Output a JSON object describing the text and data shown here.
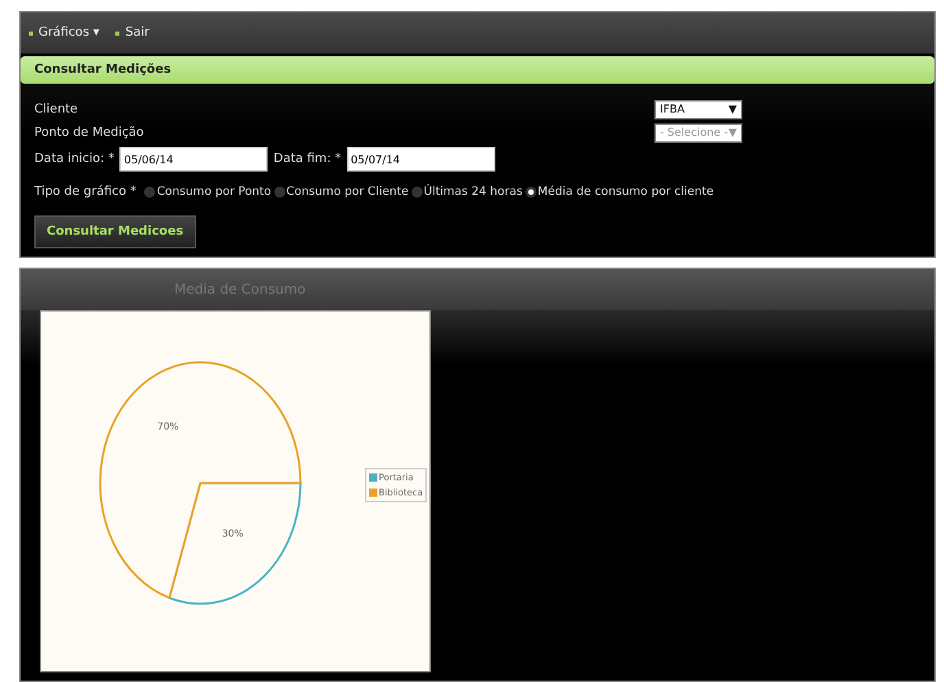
{
  "nav": [
    {
      "label": "Gráficos",
      "caret": "▾"
    },
    {
      "label": "Sair"
    }
  ],
  "form": {
    "title": "Consultar Medições",
    "cliente": {
      "label": "Cliente",
      "value": "IFBA",
      "arrow": "▼"
    },
    "ponto": {
      "label": "Ponto de Medição",
      "placeholder": "- Selecione -",
      "arrow": "▼"
    },
    "data_inicio": {
      "label": "Data inicio: *",
      "value": "05/06/14"
    },
    "data_fim": {
      "label": "Data fim: *",
      "value": "05/07/14"
    },
    "tipo_label": "Tipo de gráfico *",
    "tipos": [
      {
        "label": "Consumo por Ponto",
        "selected": false
      },
      {
        "label": "Consumo por Cliente",
        "selected": false
      },
      {
        "label": "Últimas 24 horas",
        "selected": false
      },
      {
        "label": "Média de consumo por cliente",
        "selected": true
      }
    ],
    "button": "Consultar Medicoes"
  },
  "results": {
    "chart_data": {
      "type": "pie",
      "title": "Media de Consumo",
      "categories": [
        "Portaria",
        "Biblioteca"
      ],
      "values": [
        30,
        70
      ],
      "colors": [
        "#4bb2c5",
        "#eaa228"
      ],
      "value_labels": [
        "30%",
        "70%"
      ]
    }
  }
}
